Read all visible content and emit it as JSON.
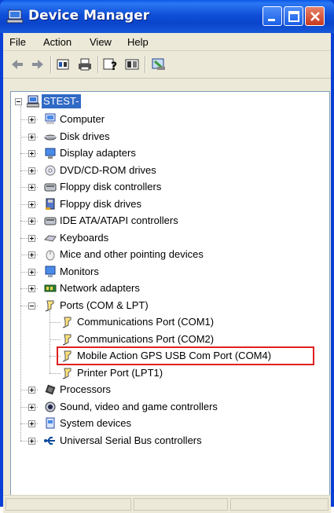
{
  "window": {
    "title": "Device Manager"
  },
  "menu": [
    "File",
    "Action",
    "View",
    "Help"
  ],
  "toolbar": {
    "buttons": [
      "back-icon",
      "forward-icon",
      "properties-icon",
      "print-icon",
      "help-icon",
      "show-hide-tree-icon",
      "scan-hardware-icon"
    ]
  },
  "tree": {
    "root": "STEST-",
    "categories": [
      {
        "label": "Computer",
        "icon": "computer-icon"
      },
      {
        "label": "Disk drives",
        "icon": "disk-drive-icon"
      },
      {
        "label": "Display adapters",
        "icon": "display-adapter-icon"
      },
      {
        "label": "DVD/CD-ROM drives",
        "icon": "dvd-drive-icon"
      },
      {
        "label": "Floppy disk controllers",
        "icon": "floppy-controller-icon"
      },
      {
        "label": "Floppy disk drives",
        "icon": "floppy-drive-icon"
      },
      {
        "label": "IDE ATA/ATAPI controllers",
        "icon": "ide-controller-icon"
      },
      {
        "label": "Keyboards",
        "icon": "keyboard-icon"
      },
      {
        "label": "Mice and other pointing devices",
        "icon": "mouse-icon"
      },
      {
        "label": "Monitors",
        "icon": "monitor-icon"
      },
      {
        "label": "Network adapters",
        "icon": "network-adapter-icon"
      },
      {
        "label": "Ports (COM & LPT)",
        "icon": "port-icon",
        "expanded": true,
        "children": [
          {
            "label": "Communications Port (COM1)",
            "icon": "port-icon"
          },
          {
            "label": "Communications Port (COM2)",
            "icon": "port-icon"
          },
          {
            "label": "Mobile Action GPS USB Com Port (COM4)",
            "icon": "port-icon",
            "highlighted": true
          },
          {
            "label": "Printer Port (LPT1)",
            "icon": "port-icon"
          }
        ]
      },
      {
        "label": "Processors",
        "icon": "processor-icon"
      },
      {
        "label": "Sound, video and game controllers",
        "icon": "sound-icon"
      },
      {
        "label": "System devices",
        "icon": "system-device-icon"
      },
      {
        "label": "Universal Serial Bus controllers",
        "icon": "usb-icon"
      }
    ]
  },
  "colors": {
    "titlebar": "#0a4fd8",
    "selection": "#316ac5",
    "highlight_box": "#e02020",
    "client_bg": "#ece9d8"
  }
}
